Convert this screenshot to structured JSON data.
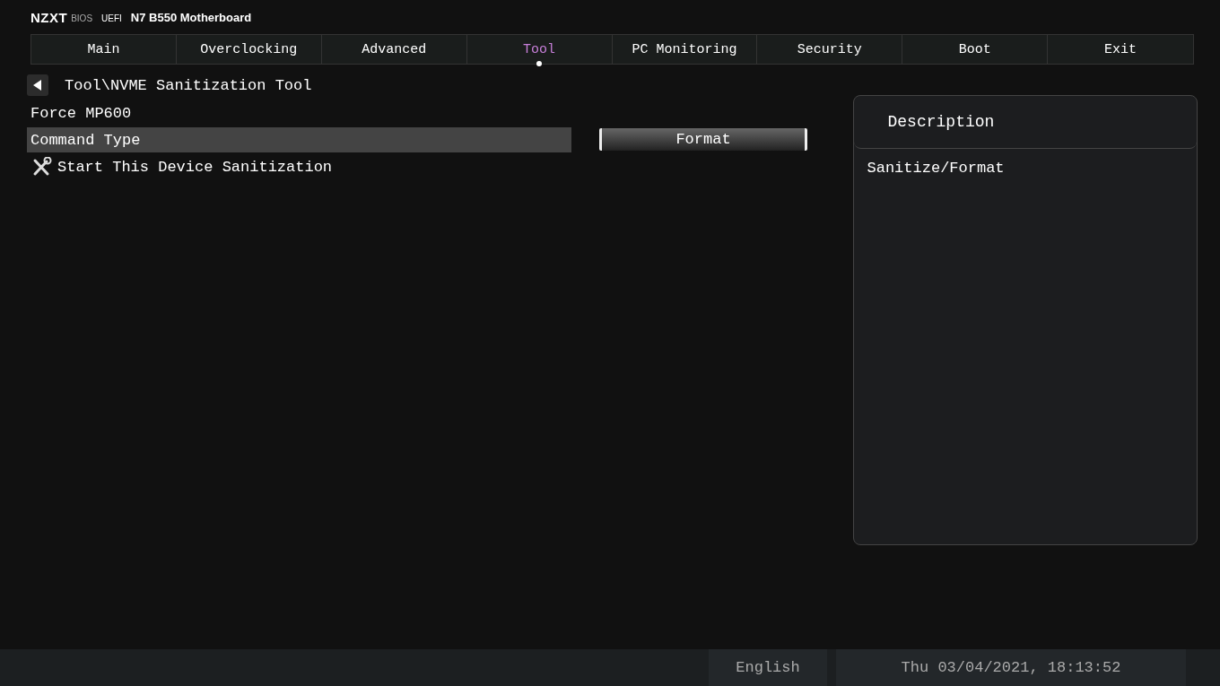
{
  "header": {
    "brand": "NZXT",
    "brand_sub": "BIOS",
    "firmware": "UEFI",
    "model": "N7 B550 Motherboard"
  },
  "tabs": [
    {
      "label": "Main",
      "selected": false
    },
    {
      "label": "Overclocking",
      "selected": false
    },
    {
      "label": "Advanced",
      "selected": false
    },
    {
      "label": "Tool",
      "selected": true
    },
    {
      "label": "PC Monitoring",
      "selected": false
    },
    {
      "label": "Security",
      "selected": false
    },
    {
      "label": "Boot",
      "selected": false
    },
    {
      "label": "Exit",
      "selected": false
    }
  ],
  "breadcrumb": "Tool\\NVME Sanitization Tool",
  "items": [
    {
      "kind": "text",
      "label": "Force MP600",
      "selected": false
    },
    {
      "kind": "setting",
      "label": "Command Type",
      "value": "Format",
      "selected": true
    },
    {
      "kind": "action",
      "label": "Start This Device Sanitization",
      "selected": false
    }
  ],
  "description": {
    "title": "Description",
    "text": "Sanitize/Format"
  },
  "status_bar": {
    "language": "English",
    "datetime": "Thu 03/04/2021, 18:13:52"
  }
}
